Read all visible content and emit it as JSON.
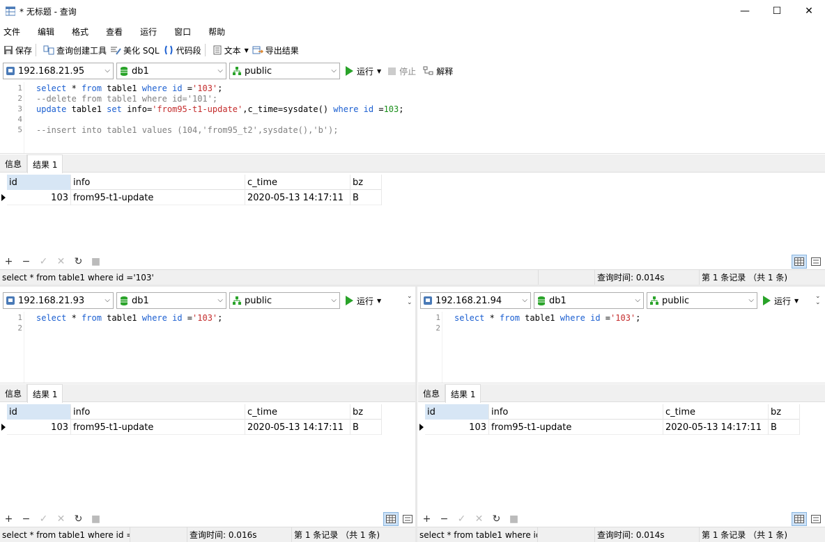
{
  "window": {
    "title": "* 无标题 - 查询",
    "minimize": "—",
    "maximize": "☐",
    "close": "✕"
  },
  "menu": [
    "文件",
    "编辑",
    "格式",
    "查看",
    "运行",
    "窗口",
    "帮助"
  ],
  "toolbar": {
    "save": "保存",
    "query_builder": "查询创建工具",
    "beautify": "美化 SQL",
    "snippet": "代码段",
    "text": "文本",
    "export": "导出结果"
  },
  "run_labels": {
    "run": "运行",
    "stop": "停止",
    "explain": "解释"
  },
  "result_tabs": {
    "info": "信息",
    "result": "结果 1"
  },
  "columns": [
    "id",
    "info",
    "c_time",
    "bz"
  ],
  "panes": {
    "top": {
      "host": "192.168.21.95",
      "db": "db1",
      "schema": "public",
      "line_numbers": [
        "1",
        "2",
        "3",
        "4",
        "5"
      ],
      "row": [
        "103",
        "from95-t1-update",
        "2020-05-13 14:17:11",
        "B"
      ],
      "status_sql": "select * from table1 where id ='103'",
      "status_time": "查询时间: 0.014s",
      "status_count": "第 1 条记录 （共 1 条)"
    },
    "left": {
      "host": "192.168.21.93",
      "db": "db1",
      "schema": "public",
      "line_numbers": [
        "1",
        "2"
      ],
      "row": [
        "103",
        "from95-t1-update",
        "2020-05-13 14:17:11",
        "B"
      ],
      "status_sql": "select * from table1 where id =",
      "status_time": "查询时间: 0.016s",
      "status_count": "第 1 条记录 （共 1 条)"
    },
    "right": {
      "host": "192.168.21.94",
      "db": "db1",
      "schema": "public",
      "line_numbers": [
        "1",
        "2"
      ],
      "row": [
        "103",
        "from95-t1-update",
        "2020-05-13 14:17:11",
        "B"
      ],
      "status_sql": "select * from table1 where id",
      "status_time": "查询时间: 0.014s",
      "status_count": "第 1 条记录 （共 1 条)"
    }
  },
  "sql": {
    "select_kw": "select",
    "star": " * ",
    "from_kw": "from",
    "table": " table1 ",
    "where_kw": "where",
    "id_col": " id ",
    "eq": "=",
    "val_103": "'103'",
    "semi": ";",
    "line2": "--delete from table1 where id='101';",
    "update_kw": "update",
    "set_kw": "set",
    "info_eq": " info=",
    "val_update": "'from95-t1-update'",
    "ctime_part": ",c_time=sysdate() ",
    "num_103": "103",
    "line5": "--insert into table1 values (104,'from95_t2',sysdate(),'b');"
  },
  "grid_tools": {
    "add": "+",
    "remove": "−",
    "apply": "✓",
    "discard": "✕",
    "refresh": "↻",
    "stop": "■"
  },
  "colors": {
    "keyword": "#1b5fd1",
    "string": "#c42b2b",
    "number": "#1a8f1a",
    "comment": "#808080",
    "run": "#29a329"
  }
}
